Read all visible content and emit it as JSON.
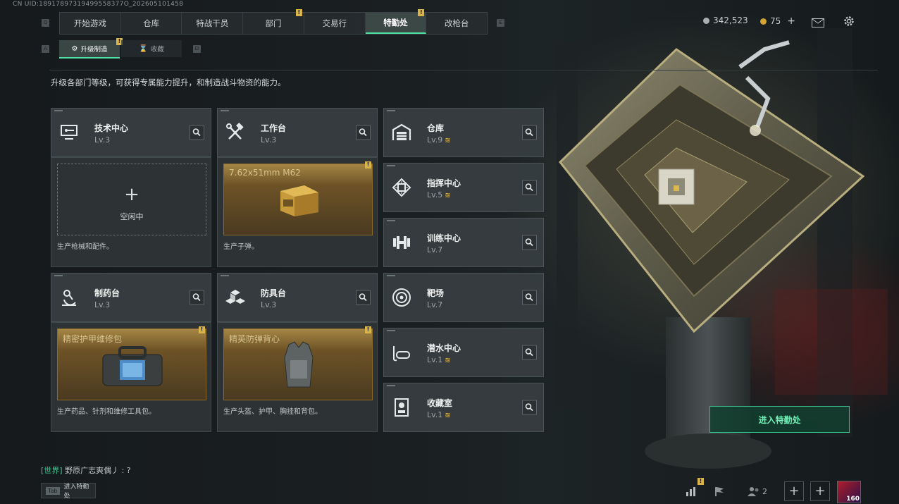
{
  "uid_text": "CN UID:18917897319499558377O_202605101458",
  "nav": {
    "key_left": "Q",
    "key_right": "E",
    "tabs": [
      {
        "label": "开始游戏",
        "badge": ""
      },
      {
        "label": "仓库",
        "badge": ""
      },
      {
        "label": "特战干员",
        "badge": ""
      },
      {
        "label": "部门",
        "badge": "!"
      },
      {
        "label": "交易行",
        "badge": ""
      },
      {
        "label": "特勤处",
        "badge": "!",
        "active": true
      },
      {
        "label": "改枪台",
        "badge": ""
      }
    ]
  },
  "currency": {
    "coins": "342,523",
    "premium": "75",
    "premium_add": "+"
  },
  "subnav": {
    "key_left": "A",
    "key_right": "D",
    "tabs": [
      {
        "label": "升级制造",
        "badge": "!",
        "active": true
      },
      {
        "label": "收藏",
        "badge": ""
      }
    ]
  },
  "description": "升级各部门等级，可获得专属能力提升，和制造战斗物资的能力。",
  "workshops": [
    {
      "name": "技术中心",
      "level": "Lv.3",
      "panel": {
        "state": "idle",
        "idle_label": "空闲中",
        "plus": "+"
      },
      "caption": "生产枪械和配件。"
    },
    {
      "name": "工作台",
      "level": "Lv.3",
      "panel": {
        "state": "producing",
        "item": "7.62x51mm M62",
        "badge": "!"
      },
      "caption": "生产子弹。"
    },
    {
      "name": "制药台",
      "level": "Lv.3",
      "panel": {
        "state": "producing",
        "item": "精密护甲维修包",
        "badge": "!"
      },
      "caption": "生产药品、针剂和维修工具包。"
    },
    {
      "name": "防具台",
      "level": "Lv.3",
      "panel": {
        "state": "producing",
        "item": "精英防弹背心",
        "badge": "!"
      },
      "caption": "生产头盔、护甲、胸挂和背包。"
    }
  ],
  "departments": [
    {
      "name": "仓库",
      "level": "Lv.9",
      "up": true,
      "icon": "garage-icon"
    },
    {
      "name": "指挥中心",
      "level": "Lv.5",
      "up": true,
      "icon": "chip-icon"
    },
    {
      "name": "训练中心",
      "level": "Lv.7",
      "up": false,
      "icon": "dumbbell-icon"
    },
    {
      "name": "靶场",
      "level": "Lv.7",
      "up": false,
      "icon": "target-icon"
    },
    {
      "name": "潜水中心",
      "level": "Lv.1",
      "up": true,
      "icon": "diving-mask-icon"
    },
    {
      "name": "收藏室",
      "level": "Lv.1",
      "up": true,
      "icon": "collection-icon"
    }
  ],
  "up_glyph": "≋",
  "enter_button": "进入特勤处",
  "chat": {
    "channel": "[世界]",
    "message": "野原广志爽偶丿 : ?"
  },
  "tab_hint": {
    "key": "Tab",
    "label": "进入特勤处"
  },
  "bottom": {
    "badge": "!",
    "friends_count": "2",
    "add1": "+",
    "add2": "+",
    "avatar_label": "160"
  },
  "colors": {
    "accent": "#4fe2a7",
    "badge": "#d8b44a",
    "upgrade": "#d6a531",
    "gold_panel": "#8c6b2c"
  }
}
